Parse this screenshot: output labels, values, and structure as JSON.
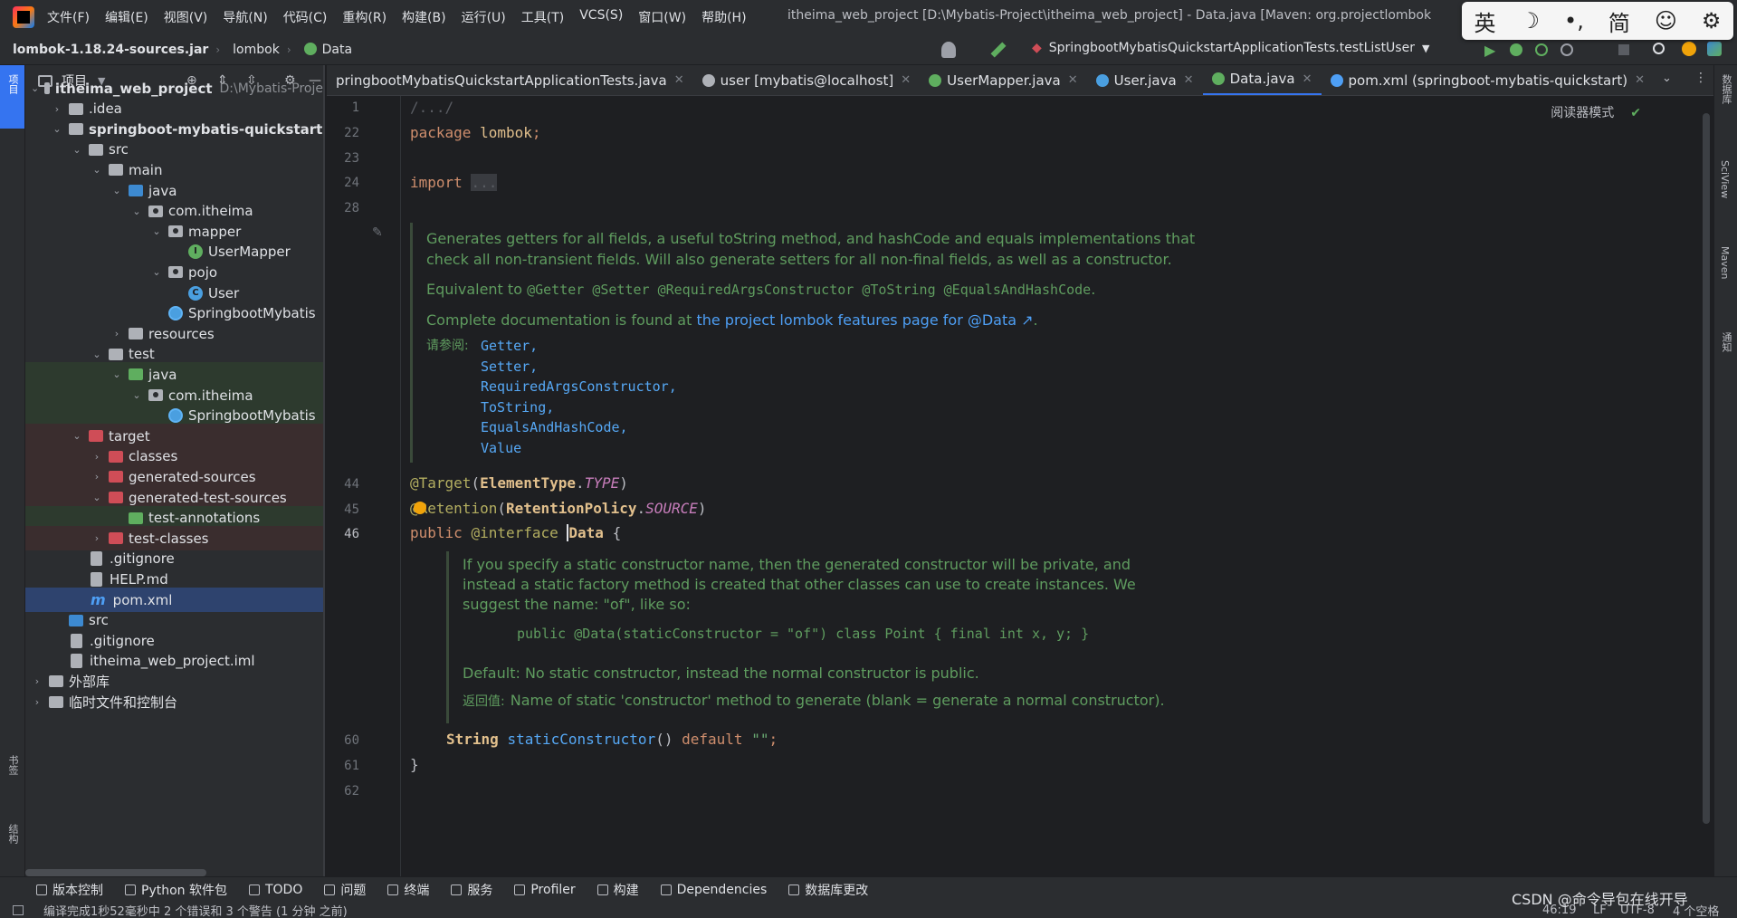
{
  "menu": [
    "文件(F)",
    "编辑(E)",
    "视图(V)",
    "导航(N)",
    "代码(C)",
    "重构(R)",
    "构建(B)",
    "运行(U)",
    "工具(T)",
    "VCS(S)",
    "窗口(W)",
    "帮助(H)"
  ],
  "window_title": "itheima_web_project [D:\\Mybatis-Project\\itheima_web_project] - Data.java [Maven: org.projectlombok",
  "ime": [
    "英",
    "☽",
    "•,",
    "简",
    "☺",
    "⚙"
  ],
  "breadcrumb": [
    "lombok-1.18.24-sources.jar",
    "lombok",
    "Data"
  ],
  "run_config": "SpringbootMybatisQuickstartApplicationTests.testListUser",
  "project_panel": {
    "title": "项目"
  },
  "tree": [
    {
      "label": "itheima_web_project",
      "sub": "D:\\Mybatis-Proje",
      "indent": 0,
      "chev": "⌄",
      "icon": "folder",
      "bold": true
    },
    {
      "label": ".idea",
      "indent": 1,
      "chev": "›",
      "icon": "folder"
    },
    {
      "label": "springboot-mybatis-quickstart",
      "indent": 1,
      "chev": "⌄",
      "icon": "folder",
      "bold": true
    },
    {
      "label": "src",
      "indent": 2,
      "chev": "⌄",
      "icon": "folder"
    },
    {
      "label": "main",
      "indent": 3,
      "chev": "⌄",
      "icon": "folder"
    },
    {
      "label": "java",
      "indent": 4,
      "chev": "⌄",
      "icon": "blue"
    },
    {
      "label": "com.itheima",
      "indent": 5,
      "chev": "⌄",
      "icon": "pkg"
    },
    {
      "label": "mapper",
      "indent": 6,
      "chev": "⌄",
      "icon": "pkg"
    },
    {
      "label": "UserMapper",
      "indent": 7,
      "chev": "",
      "icon": "i"
    },
    {
      "label": "pojo",
      "indent": 6,
      "chev": "⌄",
      "icon": "pkg"
    },
    {
      "label": "User",
      "indent": 7,
      "chev": "",
      "icon": "c"
    },
    {
      "label": "SpringbootMybatis",
      "indent": 6,
      "chev": "",
      "icon": "s"
    },
    {
      "label": "resources",
      "indent": 4,
      "chev": "›",
      "icon": "folder"
    },
    {
      "label": "test",
      "indent": 3,
      "chev": "⌄",
      "icon": "folder"
    },
    {
      "label": "java",
      "indent": 4,
      "chev": "⌄",
      "icon": "green",
      "hl": "green"
    },
    {
      "label": "com.itheima",
      "indent": 5,
      "chev": "⌄",
      "icon": "pkg",
      "hl": "green"
    },
    {
      "label": "SpringbootMybatis",
      "indent": 6,
      "chev": "",
      "icon": "s",
      "hl": "green"
    },
    {
      "label": "target",
      "indent": 2,
      "chev": "⌄",
      "icon": "red",
      "hl": "red"
    },
    {
      "label": "classes",
      "indent": 3,
      "chev": "›",
      "icon": "red",
      "hl": "red"
    },
    {
      "label": "generated-sources",
      "indent": 3,
      "chev": "›",
      "icon": "red",
      "hl": "red"
    },
    {
      "label": "generated-test-sources",
      "indent": 3,
      "chev": "⌄",
      "icon": "red",
      "hl": "red"
    },
    {
      "label": "test-annotations",
      "indent": 4,
      "chev": "",
      "icon": "green",
      "hl": "green"
    },
    {
      "label": "test-classes",
      "indent": 3,
      "chev": "›",
      "icon": "red",
      "hl": "red"
    },
    {
      "label": ".gitignore",
      "indent": 2,
      "chev": "",
      "icon": "doc"
    },
    {
      "label": "HELP.md",
      "indent": 2,
      "chev": "",
      "icon": "doc"
    },
    {
      "label": "pom.xml",
      "indent": 2,
      "chev": "",
      "icon": "m",
      "sel": true
    },
    {
      "label": "src",
      "indent": 1,
      "chev": "",
      "icon": "blue"
    },
    {
      "label": ".gitignore",
      "indent": 1,
      "chev": "",
      "icon": "doc"
    },
    {
      "label": "itheima_web_project.iml",
      "indent": 1,
      "chev": "",
      "icon": "doc"
    },
    {
      "label": "外部库",
      "indent": 0,
      "chev": "›",
      "icon": "lib"
    },
    {
      "label": "临时文件和控制台",
      "indent": 0,
      "chev": "›",
      "icon": "scratch"
    }
  ],
  "tabs": [
    {
      "label": "pringbootMybatisQuickstartApplicationTests.java",
      "icon_color": "#4a9fe0"
    },
    {
      "label": "user [mybatis@localhost]",
      "icon_color": "#aeb1b7"
    },
    {
      "label": "UserMapper.java",
      "icon_color": "#5fae5f"
    },
    {
      "label": "User.java",
      "icon_color": "#4a9fe0"
    },
    {
      "label": "Data.java",
      "icon_color": "#5fae5f",
      "active": true
    },
    {
      "label": "pom.xml (springboot-mybatis-quickstart)",
      "icon_color": "#4e9ff5"
    }
  ],
  "editor": {
    "reader_mode": "阅读器模式",
    "lines": [
      "1",
      "22",
      "23",
      "24",
      "28",
      "44",
      "45",
      "46",
      "60",
      "61",
      "62"
    ],
    "code": {
      "l1": "/.../",
      "pkg_kw": "package",
      "pkg_name": "lombok",
      "semi": ";",
      "import_kw": "import",
      "import_dots": "...",
      "target_ann": "@Target",
      "element_type": "ElementType",
      "type_const": "TYPE",
      "retention_ann": "@Retention",
      "retention_policy": "RetentionPolicy",
      "source_const": "SOURCE",
      "public_kw": "public",
      "interface_kw": "@interface",
      "data_name": "Data",
      "brace_open": "{",
      "string_type": "String",
      "static_ctor": "staticConstructor",
      "default_kw": "default",
      "empty_str": "\"\"",
      "brace_close": "}"
    },
    "doc1": {
      "p1": "Generates getters for all fields, a useful toString method, and hashCode and equals implementations that check all non-transient fields. Will also generate setters for all non-final fields, as well as a constructor.",
      "p2_prefix": "Equivalent to",
      "p2_code": "@Getter @Setter @RequiredArgsConstructor @ToString @EqualsAndHashCode",
      "p2_suffix": ".",
      "p3_prefix": "Complete documentation is found at",
      "p3_link": "the project lombok features page for @Data ↗",
      "p3_suffix": ".",
      "see_label": "请参阅:",
      "see": [
        "Getter,",
        "Setter,",
        "RequiredArgsConstructor,",
        "ToString,",
        "EqualsAndHashCode,",
        "Value"
      ]
    },
    "doc2": {
      "p1": "If you specify a static constructor name, then the generated constructor will be private, and instead a static factory method is created that other classes can use to create instances. We suggest the name: \"of\", like so:",
      "example": "public @Data(staticConstructor = \"of\") class Point { final int x, y; }",
      "p2": "Default: No static constructor, instead the normal constructor is public.",
      "ret_label": "返回值:",
      "ret": "Name of static 'constructor' method to generate (blank = generate a normal constructor)."
    }
  },
  "right_strip": [
    "数据库",
    "SciView",
    "Maven",
    "通知"
  ],
  "left_strip": [
    "项目",
    "书签",
    "结构"
  ],
  "tool_windows": [
    "版本控制",
    "Python 软件包",
    "TODO",
    "问题",
    "终端",
    "服务",
    "Profiler",
    "构建",
    "Dependencies",
    "数据库更改"
  ],
  "status": {
    "message": "编译完成1秒52毫秒中 2 个错误和 3 个警告 (1 分钟 之前)",
    "position": "46:19",
    "line_sep": "LF",
    "encoding": "UTF-8",
    "indent": "4 个空格"
  },
  "watermark": "CSDN @命令导包在线开导"
}
